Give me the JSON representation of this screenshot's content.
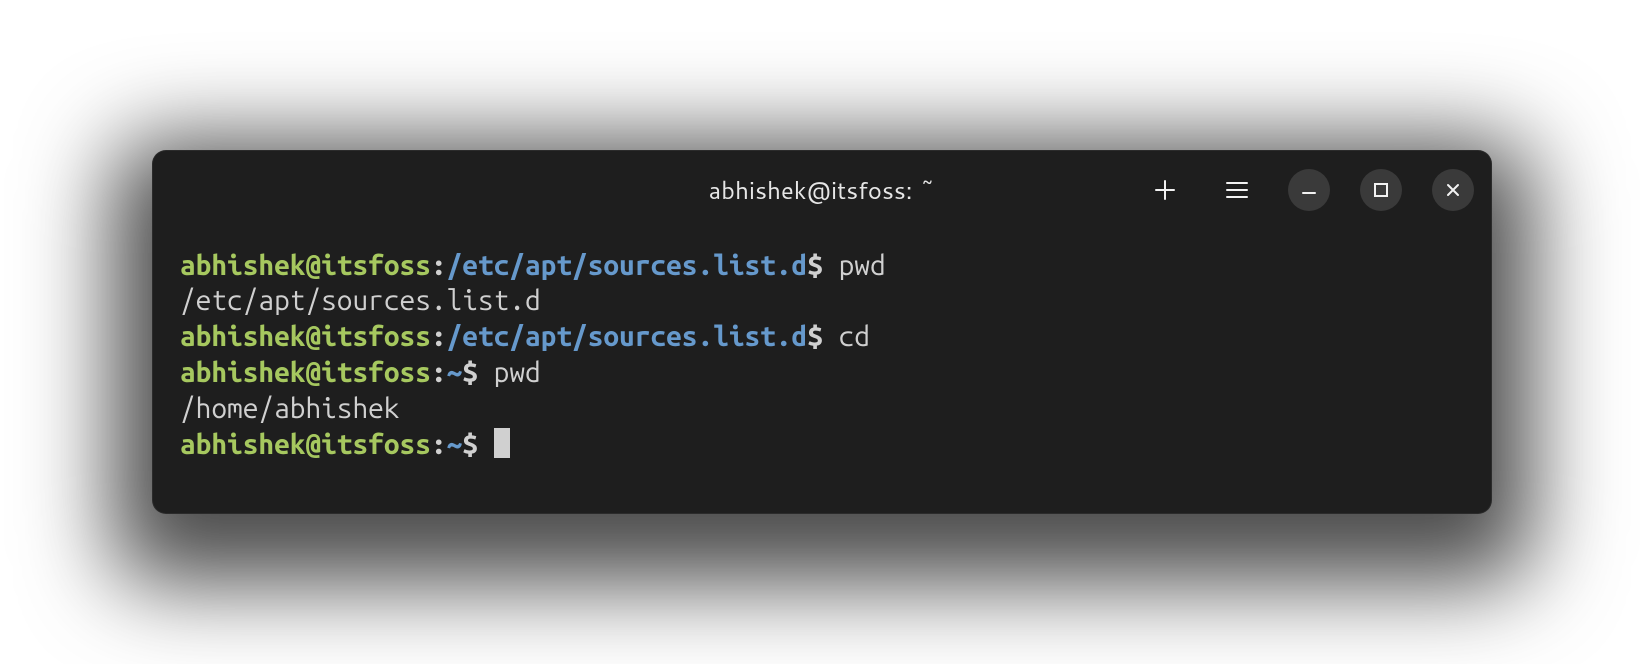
{
  "window": {
    "title": "abhishek@itsfoss: ~"
  },
  "buttons": {
    "new_tab": "plus-icon",
    "menu": "hamburger-icon",
    "minimize": "minimize-icon",
    "maximize": "maximize-icon",
    "close": "close-icon"
  },
  "lines": [
    {
      "user": "abhishek@itsfoss",
      "colon": ":",
      "path": "/etc/apt/sources.list.d",
      "dollar": "$ ",
      "cmd": "pwd"
    },
    {
      "out": "/etc/apt/sources.list.d"
    },
    {
      "user": "abhishek@itsfoss",
      "colon": ":",
      "path": "/etc/apt/sources.list.d",
      "dollar": "$ ",
      "cmd": "cd"
    },
    {
      "user": "abhishek@itsfoss",
      "colon": ":",
      "path": "~",
      "dollar": "$ ",
      "cmd": "pwd"
    },
    {
      "out": "/home/abhishek"
    },
    {
      "user": "abhishek@itsfoss",
      "colon": ":",
      "path": "~",
      "dollar": "$ ",
      "cursor": true
    }
  ]
}
